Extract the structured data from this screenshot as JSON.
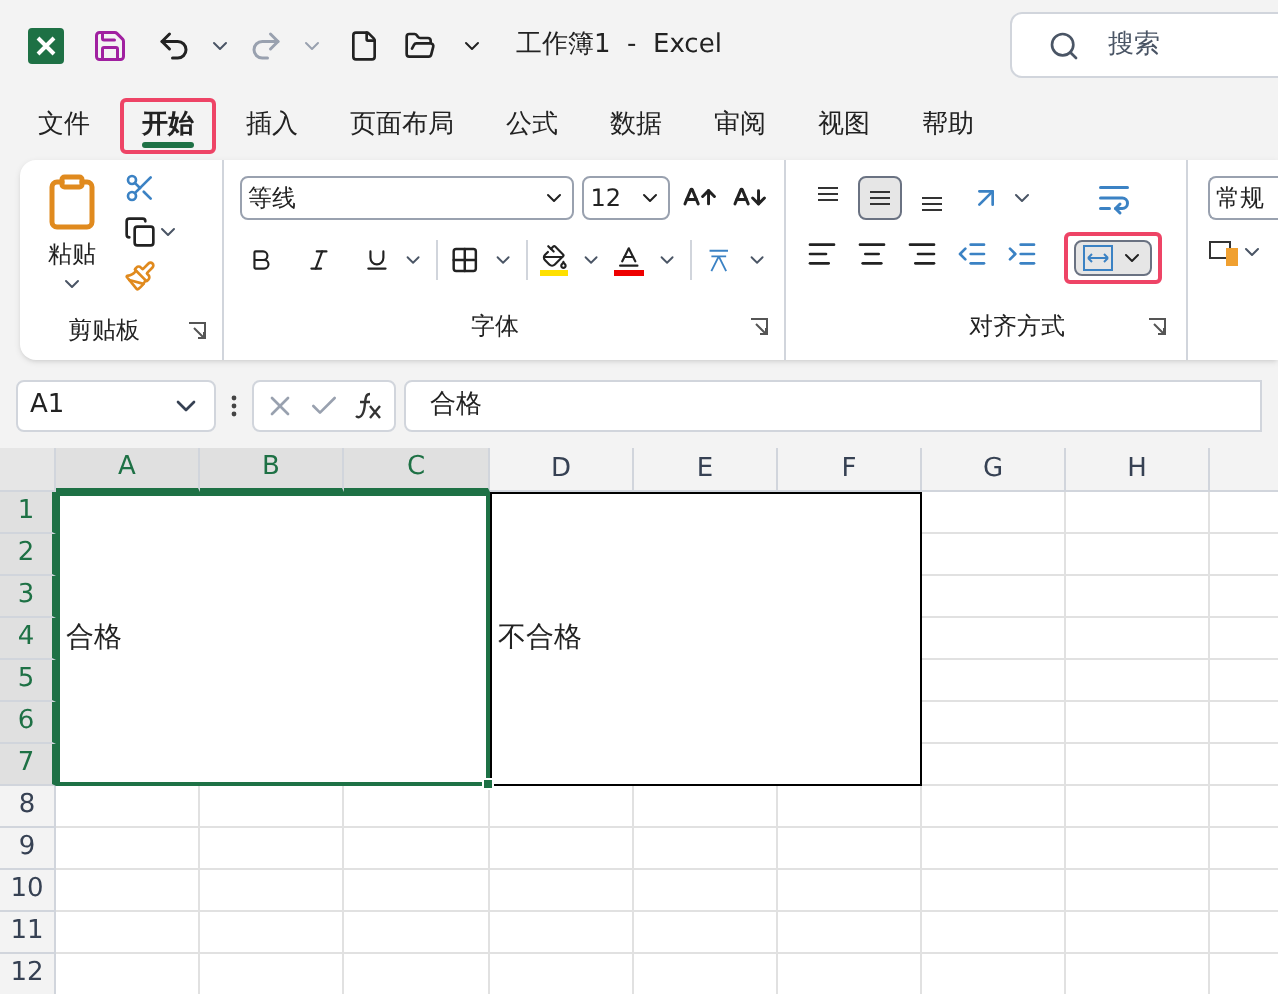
{
  "window": {
    "title": "工作簿1  -  Excel"
  },
  "search": {
    "placeholder": "搜索"
  },
  "menu_tabs": [
    {
      "label": "文件",
      "selected": false,
      "highlighted": false
    },
    {
      "label": "开始",
      "selected": true,
      "highlighted": true
    },
    {
      "label": "插入",
      "selected": false,
      "highlighted": false
    },
    {
      "label": "页面布局",
      "selected": false,
      "highlighted": false
    },
    {
      "label": "公式",
      "selected": false,
      "highlighted": false
    },
    {
      "label": "数据",
      "selected": false,
      "highlighted": false
    },
    {
      "label": "审阅",
      "selected": false,
      "highlighted": false
    },
    {
      "label": "视图",
      "selected": false,
      "highlighted": false
    },
    {
      "label": "帮助",
      "selected": false,
      "highlighted": false
    }
  ],
  "ribbon": {
    "paste_label": "粘贴",
    "font_name": "等线",
    "font_size": "12",
    "number_format": "常规",
    "middle_align_selected": true,
    "merge_highlighted": true,
    "groups": [
      {
        "label": "剪贴板"
      },
      {
        "label": "字体"
      },
      {
        "label": "对齐方式"
      }
    ]
  },
  "formula_bar": {
    "name_box": "A1",
    "formula": "合格"
  },
  "sheet": {
    "columns": [
      {
        "label": "A",
        "selected": true
      },
      {
        "label": "B",
        "selected": true
      },
      {
        "label": "C",
        "selected": true
      },
      {
        "label": "D",
        "selected": false
      },
      {
        "label": "E",
        "selected": false
      },
      {
        "label": "F",
        "selected": false
      },
      {
        "label": "G",
        "selected": false
      },
      {
        "label": "H",
        "selected": false
      }
    ],
    "rows": [
      {
        "label": "1",
        "selected": true
      },
      {
        "label": "2",
        "selected": true
      },
      {
        "label": "3",
        "selected": true
      },
      {
        "label": "4",
        "selected": true
      },
      {
        "label": "5",
        "selected": true
      },
      {
        "label": "6",
        "selected": true
      },
      {
        "label": "7",
        "selected": true
      },
      {
        "label": "8",
        "selected": false
      },
      {
        "label": "9",
        "selected": false
      },
      {
        "label": "10",
        "selected": false
      },
      {
        "label": "11",
        "selected": false
      },
      {
        "label": "12",
        "selected": false
      }
    ],
    "merged_cells": [
      {
        "text": "合格",
        "selected": true
      },
      {
        "text": "不合格",
        "selected": false
      }
    ]
  }
}
